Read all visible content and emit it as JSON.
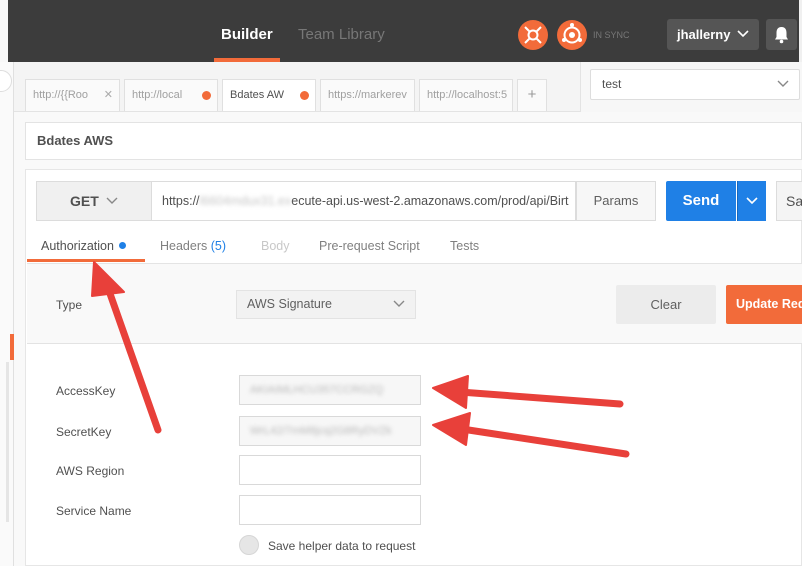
{
  "header": {
    "tabs": [
      "Builder",
      "Team Library"
    ],
    "sync_status": "IN SYNC",
    "username": "jhallerny",
    "icons": [
      "interceptor-icon",
      "sync-icon",
      "chevron-down-icon",
      "bell-icon"
    ]
  },
  "request_tabs": [
    {
      "label": "http://{{Roo",
      "state": "close"
    },
    {
      "label": "http://local",
      "state": "unsaved"
    },
    {
      "label": "Bdates AW",
      "state": "unsaved-active"
    },
    {
      "label": "https://markerev",
      "state": "plain"
    },
    {
      "label": "http://localhost:5",
      "state": "plain"
    }
  ],
  "add_tab_label": "+",
  "close_glyph": "✕",
  "environment": {
    "selected": "test"
  },
  "request": {
    "name": "Bdates AWS",
    "method": "GET",
    "url_prefix": "https://",
    "url_hidden": "l6604mdux31.ex",
    "url_rest": "ecute-api.us-west-2.amazonaws.com/prod/api/Birt",
    "params_label": "Params",
    "send_label": "Send",
    "save_label": "Sa"
  },
  "subtabs": {
    "authorization": "Authorization",
    "headers": "Headers",
    "headers_count": "(5)",
    "body": "Body",
    "prerequest": "Pre-request Script",
    "tests": "Tests"
  },
  "auth": {
    "type_label": "Type",
    "type_value": "AWS Signature",
    "clear_label": "Clear",
    "update_label": "Update Requ",
    "fields": {
      "access_key_label": "AccessKey",
      "access_key_value": "AKIAIMLHCU357CCRGZQ",
      "secret_key_label": "SecretKey",
      "secret_key_value": "WrL42/7mM8jcq2G8RyDVZk",
      "region_label": "AWS Region",
      "region_value": "",
      "service_label": "Service Name",
      "service_value": ""
    },
    "save_helper_label": "Save helper data to request"
  },
  "colors": {
    "accent": "#f26b3a",
    "send_blue": "#1f80e6",
    "annotation_red": "#e8403a"
  }
}
